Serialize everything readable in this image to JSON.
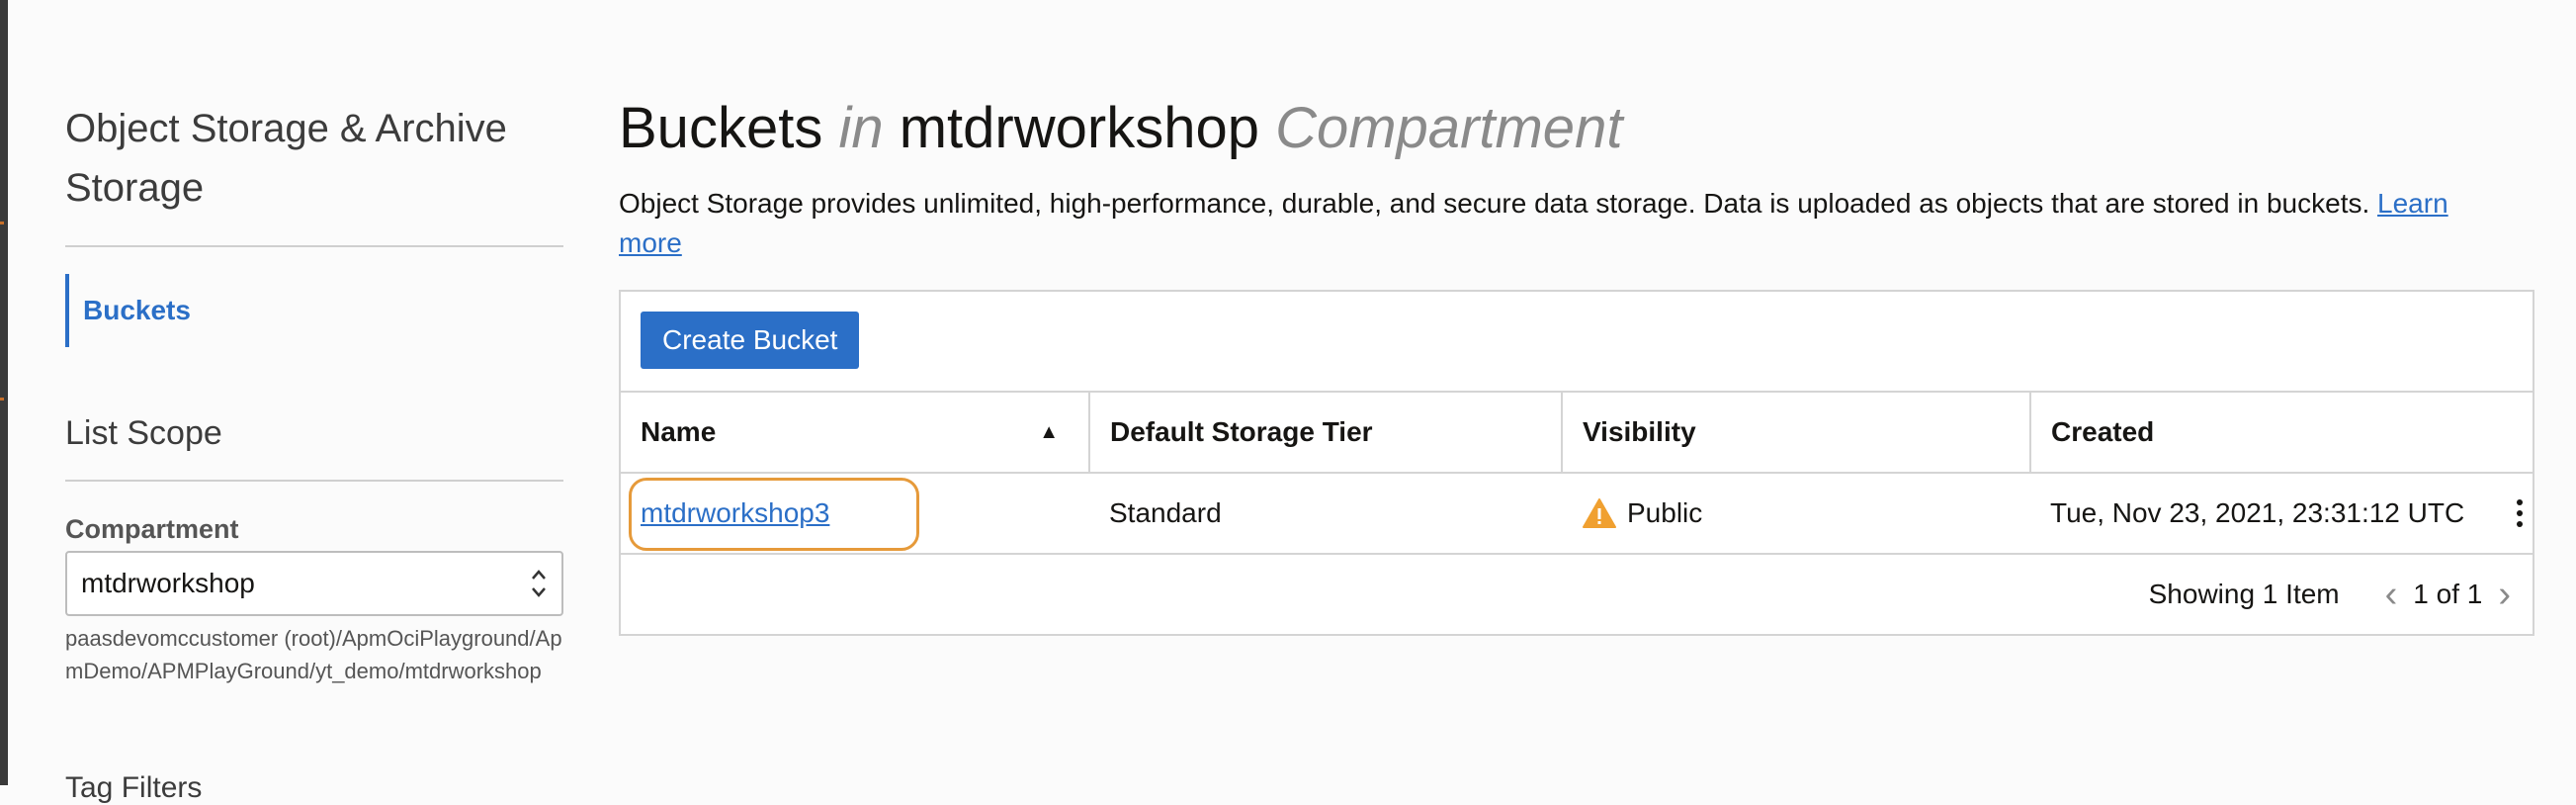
{
  "sidebar": {
    "title": "Object Storage & Archive Storage",
    "nav_items": [
      {
        "label": "Buckets",
        "active": true
      }
    ],
    "list_scope_title": "List Scope",
    "compartment_label": "Compartment",
    "compartment_value": "mtdrworkshop",
    "compartment_path": "paasdevomccustomer (root)/ApmOciPlayground/ApmDemo/APMPlayGround/yt_demo/mtdrworkshop",
    "cutoff_text": "Tag Filters"
  },
  "main": {
    "title_part1": "Buckets",
    "title_in": "in",
    "title_compartment": "mtdrworkshop",
    "title_suffix": "Compartment",
    "description": "Object Storage provides unlimited, high-performance, durable, and secure data storage. Data is uploaded as objects that are stored in buckets.",
    "learn_more": "Learn more"
  },
  "toolbar": {
    "create_bucket_label": "Create Bucket"
  },
  "table": {
    "columns": [
      "Name",
      "Default Storage Tier",
      "Visibility",
      "Created"
    ],
    "rows": [
      {
        "name": "mtdrworkshop3",
        "tier": "Standard",
        "visibility": "Public",
        "created": "Tue, Nov 23, 2021, 23:31:12 UTC"
      }
    ]
  },
  "pager": {
    "showing": "Showing 1 Item",
    "page": "1 of 1"
  },
  "colors": {
    "accent": "#2b6fc7",
    "highlight": "#e69a3a",
    "warning": "#f0a030"
  },
  "icons": [
    "sort-ascending-icon",
    "warning-icon",
    "kebab-menu-icon",
    "chevron-left-icon",
    "chevron-right-icon",
    "select-arrows-icon"
  ]
}
